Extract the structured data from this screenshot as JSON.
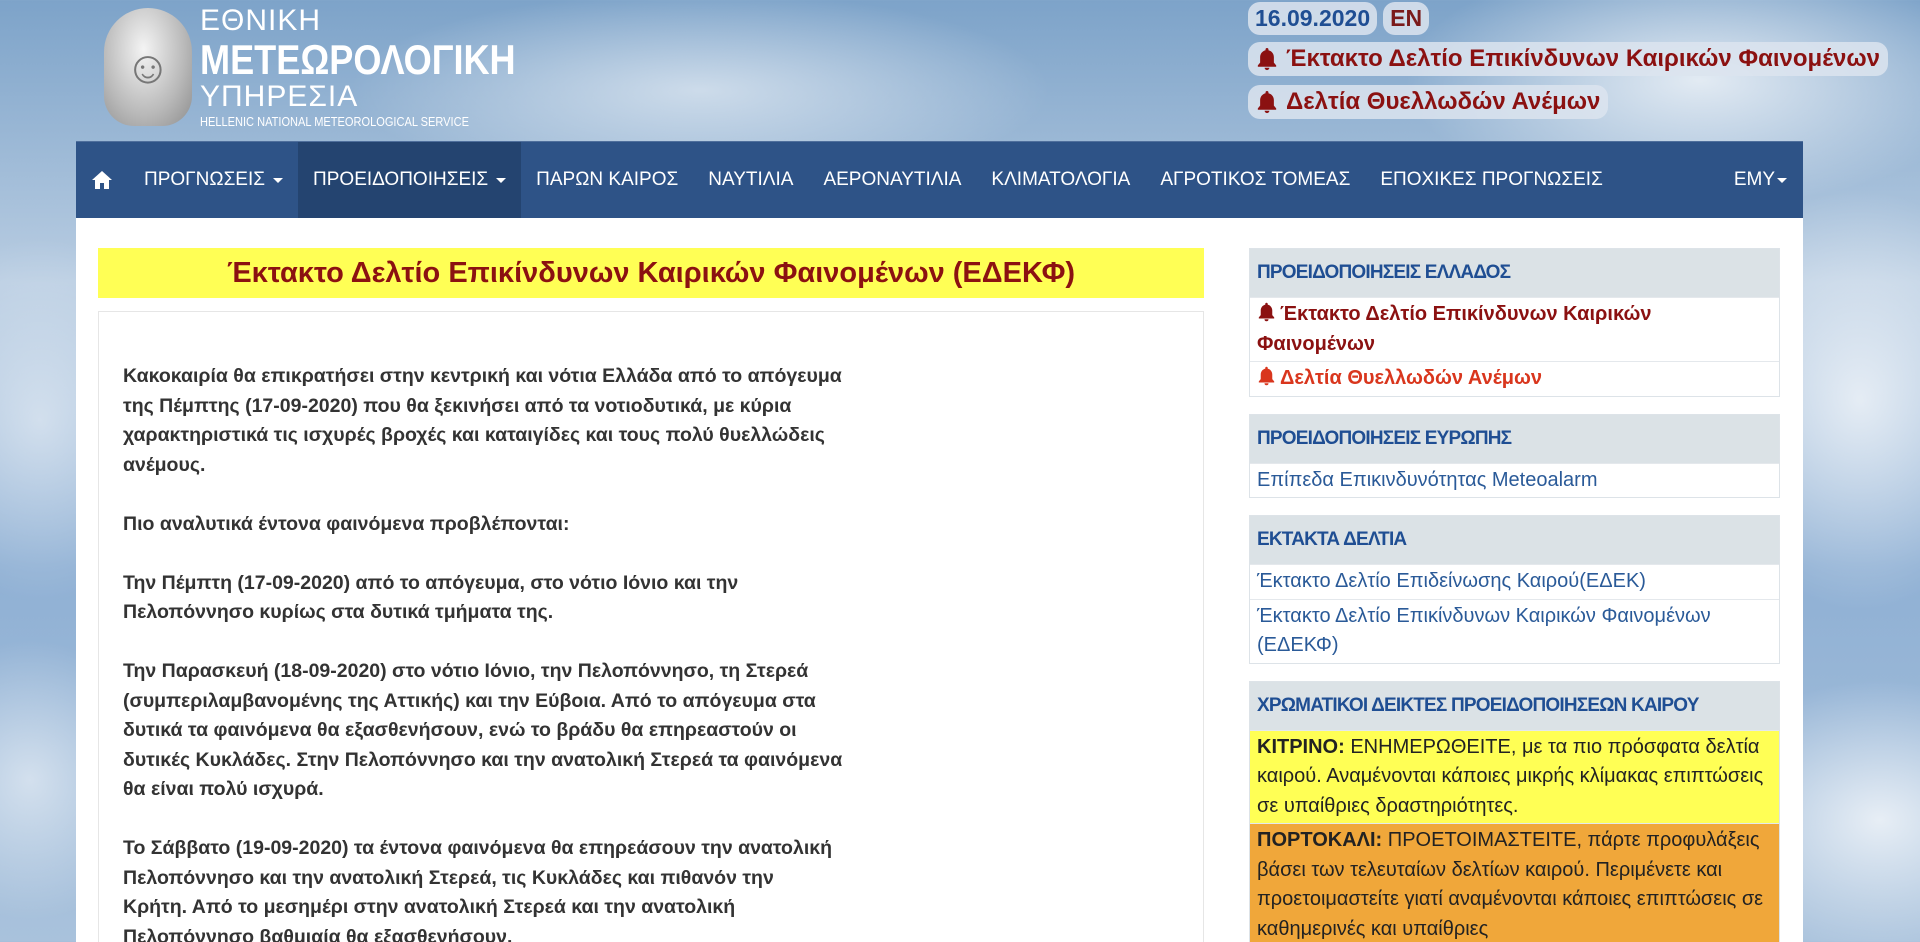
{
  "header": {
    "logo_line1": "ΕΘΝΙΚΗ",
    "logo_line2": "ΜΕΤΕΩΡΟΛΟΓΙΚΗ",
    "logo_line3": "ΥΠΗΡΕΣΙΑ",
    "logo_line4": "HELLENIC NATIONAL METEOROLOGICAL SERVICE",
    "date": "16.09.2020",
    "language": "EN",
    "alert1": "Έκτακτο Δελτίο Επικίνδυνων Καιρικών Φαινομένων",
    "alert2": "Δελτία Θυελλωδών Ανέμων"
  },
  "nav": {
    "items": [
      {
        "label": "ΠΡΟΓΝΩΣΕΙΣ"
      },
      {
        "label": "ΠΡΟΕΙΔΟΠΟΙΗΣΕΙΣ"
      },
      {
        "label": "ΠΑΡΩΝ ΚΑΙΡΟΣ"
      },
      {
        "label": "ΝΑΥΤΙΛΙΑ"
      },
      {
        "label": "ΑΕΡΟΝΑΥΤΙΛΙΑ"
      },
      {
        "label": "ΚΛΙΜΑΤΟΛΟΓΙΑ"
      },
      {
        "label": "ΑΓΡΟΤΙΚΟΣ ΤΟΜΕΑΣ"
      },
      {
        "label": "ΕΠΟΧΙΚΕΣ ΠΡΟΓΝΩΣΕΙΣ"
      }
    ],
    "emy": "ΕΜΥ"
  },
  "main": {
    "title": "Έκτακτο Δελτίο Επικίνδυνων Καιρικών Φαινομένων (ΕΔΕΚΦ)",
    "paragraphs": [
      "Κακοκαιρία θα επικρατήσει στην κεντρική και νότια Ελλάδα από το απόγευμα της Πέμπτης (17-09-2020) που θα ξεκινήσει από τα νοτιοδυτικά, με κύρια χαρακτηριστικά τις ισχυρές βροχές και καταιγίδες και τους πολύ θυελλώδεις ανέμους.",
      "Πιο αναλυτικά έντονα φαινόμενα προβλέπονται:",
      "Την Πέμπτη (17-09-2020) από το απόγευμα, στο νότιο Ιόνιο και την Πελοπόννησο κυρίως στα δυτικά τμήματα της.",
      "Την Παρασκευή (18-09-2020) στο νότιο Ιόνιο, την Πελοπόννησο, τη Στερεά (συμπεριλαμβανομένης της Αττικής) και την Εύβοια. Από το απόγευμα στα δυτικά τα φαινόμενα θα εξασθενήσουν, ενώ το βράδυ θα επηρεαστούν οι δυτικές Κυκλάδες. Στην Πελοπόννησο και την ανατολική Στερεά τα φαινόμενα θα είναι πολύ ισχυρά.",
      "Το Σάββατο (19-09-2020) τα έντονα φαινόμενα θα επηρεάσουν την ανατολική Πελοπόννησο και την ανατολική Στερεά, τις Κυκλάδες και πιθανόν την Κρήτη. Από το μεσημέρι στην ανατολική Στερεά και την ανατολική Πελοπόννησο βαθμιαία θα εξασθενήσουν."
    ]
  },
  "sidebar": {
    "greece": {
      "title": "ΠΡΟΕΙΔΟΠΟΙΗΣΕΙΣ ΕΛΛΑΔΟΣ",
      "link1": "Έκτακτο Δελτίο Επικίνδυνων Καιρικών Φαινομένων",
      "link2": "Δελτία Θυελλωδών Ανέμων"
    },
    "europe": {
      "title": "ΠΡΟΕΙΔΟΠΟΙΗΣΕΙΣ ΕΥΡΩΠΗΣ",
      "link1": "Επίπεδα Επικινδυνότητας Meteoalarm"
    },
    "extra": {
      "title": "ΕΚΤΑΚΤΑ ΔΕΛΤΙΑ",
      "link1": "Έκτακτο Δελτίο Επιδείνωσης Καιρού(ΕΔΕΚ)",
      "link2": "Έκτακτο Δελτίο Επικίνδυνων Καιρικών Φαινομένων (ΕΔΕΚΦ)"
    },
    "colors": {
      "title": "ΧΡΩΜΑΤΙΚΟΙ ΔΕΙΚΤΕΣ ΠΡΟΕΙΔΟΠΟΙΗΣΕΩΝ ΚΑΙΡΟΥ",
      "yellow_label": "ΚΙΤΡΙΝΟ:",
      "yellow_text": " ΕΝΗΜΕΡΩΘΕΙΤΕ, με τα πιο πρόσφατα δελτία καιρού. Αναμένονται κάποιες μικρής κλίμακας επιπτώσεις σε υπαίθριες δραστηριότητες.",
      "orange_label": "ΠΟΡΤΟΚΑΛΙ:",
      "orange_text": " ΠΡΟΕΤΟΙΜΑΣΤΕΙΤΕ, πάρτε προφυλάξεις βάσει των τελευταίων δελτίων καιρού. Περιμένετε και προετοιμαστείτε γιατί αναμένονται κάποιες επιπτώσεις σε καθημερινές και υπαίθριες"
    }
  },
  "colors": {
    "nav_bg": "#2e5387",
    "title_bg": "#ffff55",
    "alert_red": "#8b1111",
    "link_blue": "#2a5a98",
    "orange": "#f0a73a"
  }
}
